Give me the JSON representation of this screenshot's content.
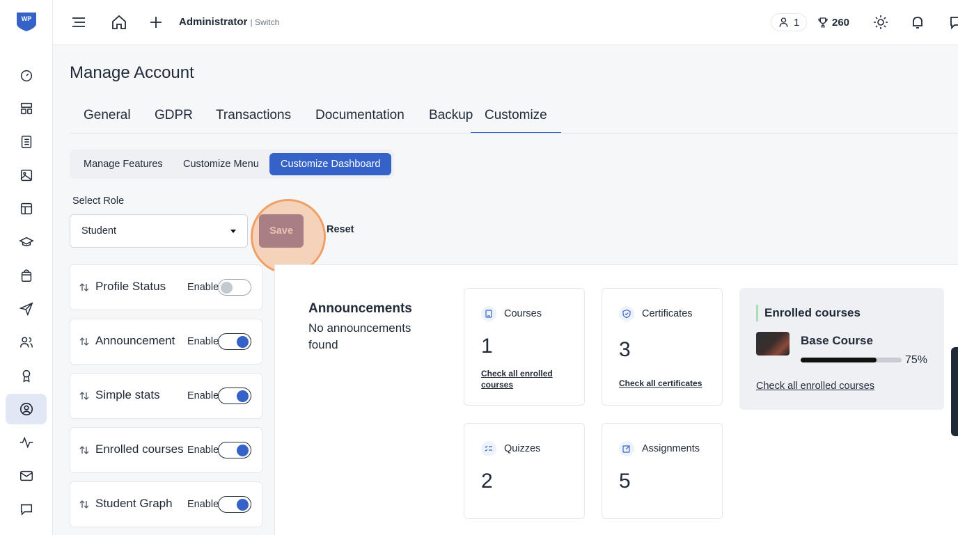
{
  "app": {
    "logo_text": "WP",
    "brand_color": "#3562c7"
  },
  "sidebar": {
    "items": [
      {
        "icon": "gauge-icon"
      },
      {
        "icon": "layout-icon"
      },
      {
        "icon": "book-list-icon"
      },
      {
        "icon": "image-icon"
      },
      {
        "icon": "template-icon"
      },
      {
        "icon": "graduation-cap-icon"
      },
      {
        "icon": "shopping-bag-icon"
      },
      {
        "icon": "send-icon"
      },
      {
        "icon": "users-icon"
      },
      {
        "icon": "award-icon"
      },
      {
        "icon": "user-circle-icon",
        "active": true
      },
      {
        "icon": "activity-icon"
      },
      {
        "icon": "mail-icon"
      },
      {
        "icon": "chat-icon"
      }
    ]
  },
  "topbar": {
    "user": "Administrator",
    "switch": "| Switch",
    "online_count": "1",
    "points": "260"
  },
  "page": {
    "title": "Manage Account",
    "tabs": [
      "General",
      "GDPR",
      "Transactions",
      "Documentation",
      "Backup",
      "Customize"
    ],
    "active_tab": "Customize",
    "subtabs": [
      "Manage Features",
      "Customize Menu",
      "Customize Dashboard"
    ],
    "active_subtab": "Customize Dashboard"
  },
  "role": {
    "label": "Select Role",
    "value": "Student",
    "save": "Save",
    "reset": "Reset"
  },
  "widgets": [
    {
      "name": "Profile Status",
      "toggle_label": "Enable",
      "enabled": false
    },
    {
      "name": "Announcement",
      "toggle_label": "Enable",
      "enabled": true
    },
    {
      "name": "Simple stats",
      "toggle_label": "Enable",
      "enabled": true
    },
    {
      "name": "Enrolled courses",
      "toggle_label": "Enable",
      "enabled": true
    },
    {
      "name": "Student Graph",
      "toggle_label": "Enable",
      "enabled": true
    }
  ],
  "preview": {
    "announcements": {
      "title": "Announcements",
      "text": "No announcements found"
    },
    "stats": [
      {
        "label": "Courses",
        "value": "1",
        "link": "Check all enrolled courses",
        "icon": "book-icon"
      },
      {
        "label": "Certificates",
        "value": "3",
        "link": "Check all certificates",
        "icon": "shield-icon"
      },
      {
        "label": "Quizzes",
        "value": "2",
        "icon": "checklist-icon"
      },
      {
        "label": "Assignments",
        "value": "5",
        "icon": "edit-icon"
      }
    ],
    "enrolled": {
      "title": "Enrolled courses",
      "course": "Base Course",
      "progress": 0.75,
      "progress_text": "75%",
      "link": "Check all enrolled courses"
    }
  }
}
